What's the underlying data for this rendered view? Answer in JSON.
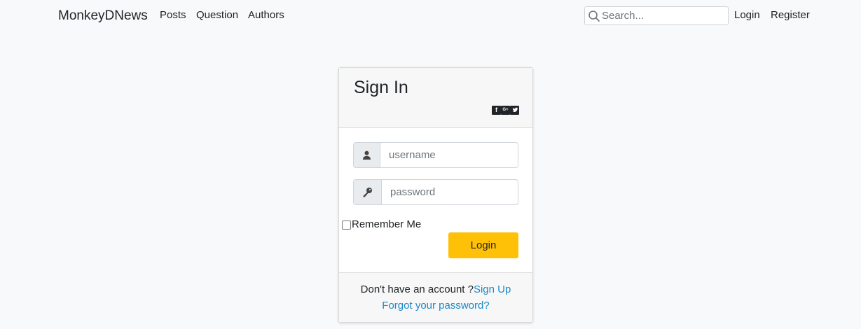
{
  "navbar": {
    "brand": "MonkeyDNews",
    "links": [
      "Posts",
      "Question",
      "Authors"
    ],
    "search": {
      "placeholder": "Search...",
      "value": "",
      "icon": "search-icon"
    },
    "login": "Login",
    "register": "Register"
  },
  "card": {
    "title": "Sign In",
    "social": [
      "facebook-icon",
      "google-plus-icon",
      "twitter-icon"
    ],
    "username": {
      "placeholder": "username",
      "value": "",
      "icon": "user-icon"
    },
    "password": {
      "placeholder": "password",
      "value": "",
      "icon": "key-icon"
    },
    "remember_label": "Remember Me",
    "remember_checked": false,
    "login_button": "Login",
    "footer": {
      "signup_prompt": "Don't have an account ?",
      "signup_link": "Sign Up",
      "forgot_link": "Forgot your password?"
    }
  },
  "colors": {
    "background": "#f8f9fa",
    "accent_button": "#ffc107",
    "link": "#1e88c7"
  }
}
